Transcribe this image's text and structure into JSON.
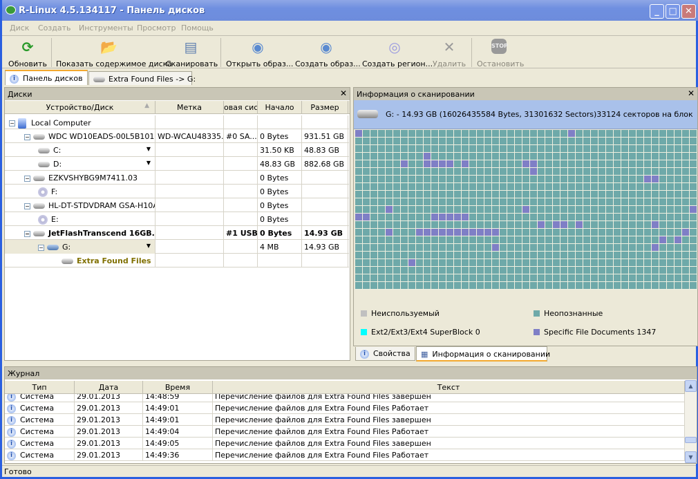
{
  "window": {
    "title": "R-Linux 4.5.134117 - Панель дисков",
    "minimize": "_",
    "maximize": "□",
    "close": "✕"
  },
  "menu": [
    "Диск",
    "Создать",
    "Инструменты",
    "Просмотр",
    "Помощь"
  ],
  "toolbar": [
    {
      "label": "Обновить",
      "icon": "refresh-icon",
      "enabled": true
    },
    {
      "label": "Показать содержимое диска",
      "icon": "folder-icon",
      "enabled": true
    },
    {
      "label": "Сканировать",
      "icon": "scan-icon",
      "enabled": true
    },
    {
      "label": "Открыть образ...",
      "icon": "open-image-icon",
      "enabled": true
    },
    {
      "label": "Создать образ...",
      "icon": "create-image-icon",
      "enabled": true
    },
    {
      "label": "Создать регион...",
      "icon": "create-region-icon",
      "enabled": true
    },
    {
      "label": "Удалить",
      "icon": "delete-icon",
      "enabled": false
    },
    {
      "label": "Остановить",
      "icon": "stop-icon",
      "enabled": false
    }
  ],
  "tabs": [
    {
      "label": "Панель дисков",
      "active": true
    },
    {
      "label": "Extra Found Files -> G:",
      "active": false
    }
  ],
  "disks": {
    "title": "Диски",
    "columns": [
      "Устройство/Диск",
      "Метка",
      "овая сис",
      "Начало",
      "Размер"
    ],
    "rows": [
      {
        "name": "Local Computer",
        "label": "",
        "fs": "",
        "start": "",
        "size": ""
      },
      {
        "name": "WDC WD10EADS-00L5B101....",
        "label": "WD-WCAU48335...",
        "fs": "#0 SA...",
        "start": "0 Bytes",
        "size": "931.51 GB"
      },
      {
        "name": "C:",
        "label": "",
        "fs": "",
        "start": "31.50 KB",
        "size": "48.83 GB"
      },
      {
        "name": "D:",
        "label": "",
        "fs": "",
        "start": "48.83 GB",
        "size": "882.68 GB"
      },
      {
        "name": "EZKVSHYBG9M7411.03",
        "label": "",
        "fs": "",
        "start": "0 Bytes",
        "size": ""
      },
      {
        "name": "F:",
        "label": "",
        "fs": "",
        "start": "0 Bytes",
        "size": ""
      },
      {
        "name": "HL-DT-STDVDRAM GSA-H10A...",
        "label": "",
        "fs": "",
        "start": "0 Bytes",
        "size": ""
      },
      {
        "name": "E:",
        "label": "",
        "fs": "",
        "start": "0 Bytes",
        "size": ""
      },
      {
        "name": "JetFlashTranscend 16GB...",
        "label": "",
        "fs": "#1 USB",
        "start": "0 Bytes",
        "size": "14.93 GB"
      },
      {
        "name": "G:",
        "label": "",
        "fs": "",
        "start": "4 MB",
        "size": "14.93 GB"
      },
      {
        "name": "Extra Found Files",
        "label": "",
        "fs": "",
        "start": "",
        "size": ""
      }
    ]
  },
  "scan": {
    "title": "Информация о сканировании",
    "summary": "G: - 14.93 GB (16026435584 Bytes, 31301632 Sectors)33124 секторов на блок",
    "map": {
      "cols": 45,
      "rows": 21,
      "specific_file_cells": [
        [
          0,
          0
        ],
        [
          0,
          28
        ],
        [
          3,
          9
        ],
        [
          4,
          6
        ],
        [
          4,
          9
        ],
        [
          4,
          10
        ],
        [
          4,
          11
        ],
        [
          4,
          12
        ],
        [
          4,
          14
        ],
        [
          4,
          22
        ],
        [
          4,
          23
        ],
        [
          5,
          23
        ],
        [
          6,
          38
        ],
        [
          6,
          39
        ],
        [
          10,
          4
        ],
        [
          10,
          22
        ],
        [
          10,
          44
        ],
        [
          11,
          0
        ],
        [
          11,
          1
        ],
        [
          11,
          10
        ],
        [
          11,
          11
        ],
        [
          11,
          12
        ],
        [
          11,
          13
        ],
        [
          11,
          14
        ],
        [
          12,
          24
        ],
        [
          12,
          26
        ],
        [
          12,
          27
        ],
        [
          12,
          29
        ],
        [
          12,
          39
        ],
        [
          13,
          4
        ],
        [
          13,
          8
        ],
        [
          13,
          9
        ],
        [
          13,
          10
        ],
        [
          13,
          11
        ],
        [
          13,
          12
        ],
        [
          13,
          13
        ],
        [
          13,
          14
        ],
        [
          13,
          15
        ],
        [
          13,
          16
        ],
        [
          13,
          17
        ],
        [
          13,
          18
        ],
        [
          13,
          43
        ],
        [
          14,
          40
        ],
        [
          14,
          42
        ],
        [
          15,
          18
        ],
        [
          15,
          39
        ],
        [
          17,
          7
        ]
      ]
    },
    "legend": [
      {
        "label": "Неиспользуемый",
        "color": "#c0c0c0"
      },
      {
        "label": "Неопознанные",
        "color": "#6ea9a9"
      },
      {
        "label": "Ext2/Ext3/Ext4 SuperBlock 0",
        "color": "#00ffff"
      },
      {
        "label": "Specific File Documents 1347",
        "color": "#7f7fc6"
      }
    ],
    "tabs": [
      {
        "label": "Свойства",
        "active": false
      },
      {
        "label": "Информация о сканировании",
        "active": true
      }
    ]
  },
  "log": {
    "title": "Журнал",
    "columns": [
      "Тип",
      "Дата",
      "Время",
      "Текст"
    ],
    "rows": [
      {
        "type": "Система",
        "date": "29.01.2013",
        "time": "14:48:59",
        "text": "Перечисление файлов для Extra Found Files завершен"
      },
      {
        "type": "Система",
        "date": "29.01.2013",
        "time": "14:49:01",
        "text": "Перечисление файлов для Extra Found Files Работает"
      },
      {
        "type": "Система",
        "date": "29.01.2013",
        "time": "14:49:01",
        "text": "Перечисление файлов для Extra Found Files завершен"
      },
      {
        "type": "Система",
        "date": "29.01.2013",
        "time": "14:49:04",
        "text": "Перечисление файлов для Extra Found Files Работает"
      },
      {
        "type": "Система",
        "date": "29.01.2013",
        "time": "14:49:05",
        "text": "Перечисление файлов для Extra Found Files завершен"
      },
      {
        "type": "Система",
        "date": "29.01.2013",
        "time": "14:49:36",
        "text": "Перечисление файлов для Extra Found Files Работает"
      }
    ]
  },
  "status": "Готово"
}
